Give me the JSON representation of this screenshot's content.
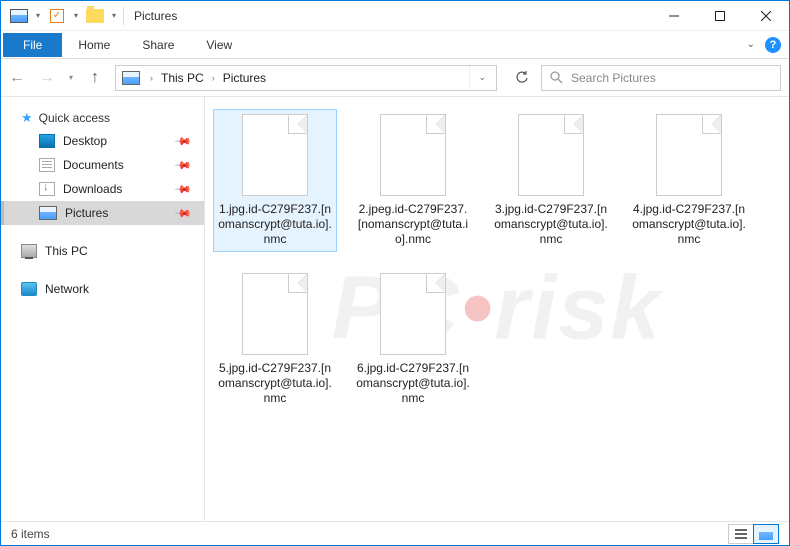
{
  "window": {
    "title": "Pictures"
  },
  "ribbon": {
    "file": "File",
    "tabs": [
      "Home",
      "Share",
      "View"
    ]
  },
  "breadcrumb": {
    "root": "This PC",
    "folder": "Pictures"
  },
  "search": {
    "placeholder": "Search Pictures"
  },
  "sidebar": {
    "quick_access": "Quick access",
    "items": [
      {
        "label": "Desktop",
        "icon": "desktop",
        "pinned": true
      },
      {
        "label": "Documents",
        "icon": "docs",
        "pinned": true
      },
      {
        "label": "Downloads",
        "icon": "dl",
        "pinned": true
      },
      {
        "label": "Pictures",
        "icon": "pics",
        "pinned": true,
        "selected": true
      }
    ],
    "thispc": "This PC",
    "network": "Network"
  },
  "files": [
    {
      "name": "1.jpg.id-C279F237.[nomanscrypt@tuta.io].nmc",
      "selected": true
    },
    {
      "name": "2.jpeg.id-C279F237.[nomanscrypt@tuta.io].nmc"
    },
    {
      "name": "3.jpg.id-C279F237.[nomanscrypt@tuta.io].nmc"
    },
    {
      "name": "4.jpg.id-C279F237.[nomanscrypt@tuta.io].nmc"
    },
    {
      "name": "5.jpg.id-C279F237.[nomanscrypt@tuta.io].nmc"
    },
    {
      "name": "6.jpg.id-C279F237.[nomanscrypt@tuta.io].nmc"
    }
  ],
  "status": {
    "count": "6 items"
  },
  "watermark": {
    "pre": "PC",
    "dot": "•",
    "post": "risk"
  }
}
